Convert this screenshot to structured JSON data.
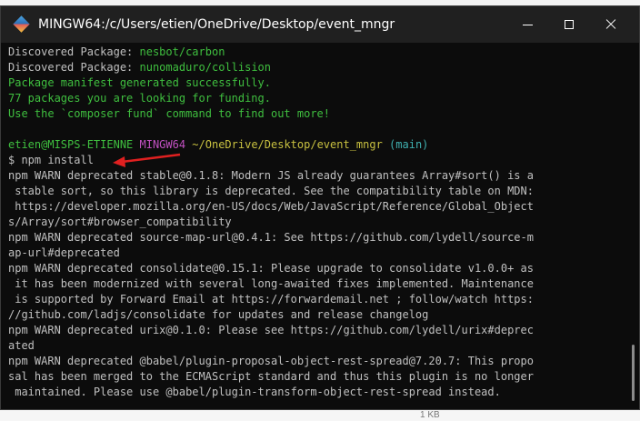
{
  "window": {
    "title": "MINGW64:/c/Users/etien/OneDrive/Desktop/event_mngr"
  },
  "terminal": {
    "lines": [
      {
        "parts": [
          {
            "text": "Discovered Package: ",
            "color": "plain"
          },
          {
            "text": "nesbot/carbon",
            "color": "green"
          }
        ]
      },
      {
        "parts": [
          {
            "text": "Discovered Package: ",
            "color": "plain"
          },
          {
            "text": "nunomaduro/collision",
            "color": "green"
          }
        ]
      },
      {
        "parts": [
          {
            "text": "Package manifest generated successfully.",
            "color": "green"
          }
        ]
      },
      {
        "parts": [
          {
            "text": "77 packages you are looking for funding.",
            "color": "green"
          }
        ]
      },
      {
        "parts": [
          {
            "text": "Use the `composer fund` command to find out more!",
            "color": "green"
          }
        ]
      },
      {
        "parts": [
          {
            "text": "",
            "color": "plain"
          }
        ]
      },
      {
        "parts": [
          {
            "text": "etien@MISPS-ETIENNE ",
            "color": "green"
          },
          {
            "text": "MINGW64 ",
            "color": "magenta"
          },
          {
            "text": "~/OneDrive/Desktop/event_mngr ",
            "color": "yellow"
          },
          {
            "text": "(main)",
            "color": "cyan"
          }
        ]
      },
      {
        "parts": [
          {
            "text": "$ npm install",
            "color": "plain"
          }
        ]
      },
      {
        "parts": [
          {
            "text": "npm WARN deprecated stable@0.1.8: Modern JS already guarantees Array#sort() is a",
            "color": "plain"
          }
        ]
      },
      {
        "parts": [
          {
            "text": " stable sort, so this library is deprecated. See the compatibility table on MDN:",
            "color": "plain"
          }
        ]
      },
      {
        "parts": [
          {
            "text": " https://developer.mozilla.org/en-US/docs/Web/JavaScript/Reference/Global_Object",
            "color": "plain"
          }
        ]
      },
      {
        "parts": [
          {
            "text": "s/Array/sort#browser_compatibility",
            "color": "plain"
          }
        ]
      },
      {
        "parts": [
          {
            "text": "npm WARN deprecated source-map-url@0.4.1: See https://github.com/lydell/source-m",
            "color": "plain"
          }
        ]
      },
      {
        "parts": [
          {
            "text": "ap-url#deprecated",
            "color": "plain"
          }
        ]
      },
      {
        "parts": [
          {
            "text": "npm WARN deprecated consolidate@0.15.1: Please upgrade to consolidate v1.0.0+ as",
            "color": "plain"
          }
        ]
      },
      {
        "parts": [
          {
            "text": " it has been modernized with several long-awaited fixes implemented. Maintenance",
            "color": "plain"
          }
        ]
      },
      {
        "parts": [
          {
            "text": " is supported by Forward Email at https://forwardemail.net ; follow/watch https:",
            "color": "plain"
          }
        ]
      },
      {
        "parts": [
          {
            "text": "//github.com/ladjs/consolidate for updates and release changelog",
            "color": "plain"
          }
        ]
      },
      {
        "parts": [
          {
            "text": "npm WARN deprecated urix@0.1.0: Please see https://github.com/lydell/urix#deprec",
            "color": "plain"
          }
        ]
      },
      {
        "parts": [
          {
            "text": "ated",
            "color": "plain"
          }
        ]
      },
      {
        "parts": [
          {
            "text": "npm WARN deprecated @babel/plugin-proposal-object-rest-spread@7.20.7: This propo",
            "color": "plain"
          }
        ]
      },
      {
        "parts": [
          {
            "text": "sal has been merged to the ECMAScript standard and thus this plugin is no longer",
            "color": "plain"
          }
        ]
      },
      {
        "parts": [
          {
            "text": " maintained. Please use @babel/plugin-transform-object-rest-spread instead.",
            "color": "plain"
          }
        ]
      }
    ]
  },
  "background": {
    "bottom_text": "1 KB"
  },
  "colors": {
    "arrow": "#e02020"
  },
  "icons": {
    "app": "git-bash-icon",
    "minimize": "minimize-icon",
    "maximize": "maximize-icon",
    "close": "close-icon",
    "annotation": "red-arrow-icon"
  }
}
